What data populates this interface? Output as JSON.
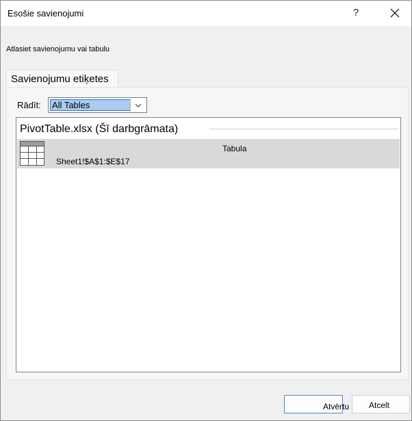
{
  "window": {
    "title": "Esošie savienojumi"
  },
  "instruction": "Atlasiet savienojumu vai tabulu",
  "tabs": [
    {
      "label": "Savienojumu etiķetes"
    }
  ],
  "filter": {
    "label": "Rādīt:",
    "selected": "All Tables"
  },
  "list": {
    "group_header": "PivotTable.xlsx (Šī darbgrāmata)",
    "items": [
      {
        "name": "Sheet1!$A$1:$E$17",
        "type": "Tabula",
        "icon": "table-icon",
        "selected": true
      }
    ]
  },
  "buttons": {
    "open": "Atvērtu",
    "cancel": "Atcelt",
    "help": "?"
  },
  "colors": {
    "selection_bg": "#d9d9d9",
    "dropdown_highlight": "#aacbf0",
    "focus_border": "#4f86c6"
  }
}
